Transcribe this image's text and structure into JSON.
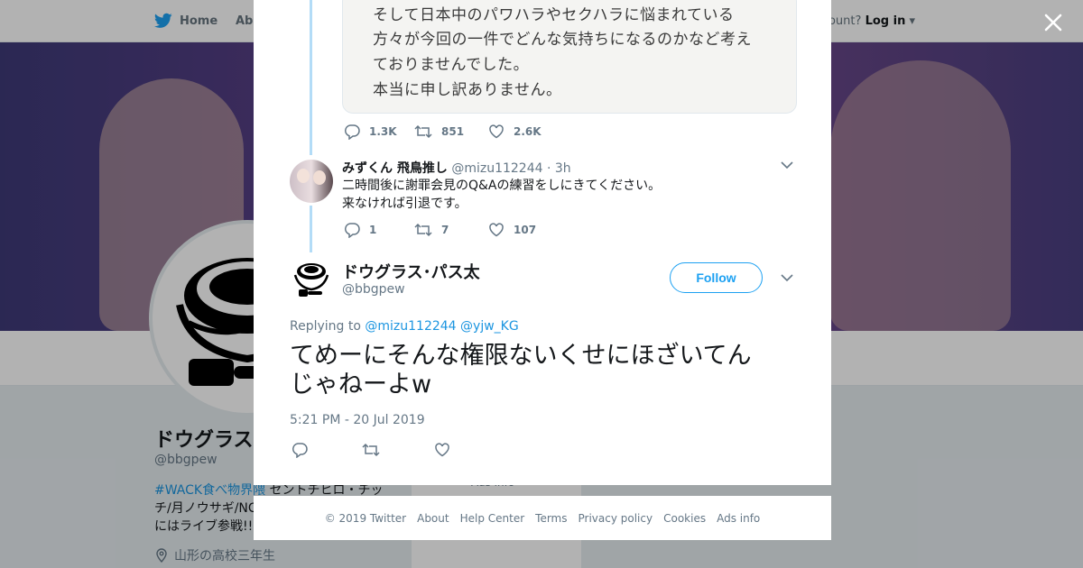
{
  "nav": {
    "home_label": "Home",
    "about_label": "Abo",
    "account_prompt": "ccount?",
    "login_label": "Log in"
  },
  "profile_bg": {
    "name": "ドウグラス",
    "handle": "@bbgpew",
    "bio_tag": "#WACK食べ物界隈",
    "bio_rest_line1": " セントチヒロ・チッ",
    "bio_line2": "チ/月ノウサギ/NC",
    "bio_line3": "にはライブ参戦!!",
    "location": "山形の高校三年生",
    "ads_info": "Ads info"
  },
  "quoted_tweet": {
    "lines": [
      "そして日本中のパワハラやセクハラに悩まれている",
      "方々が今回の一件でどんな気持ちになるのかなど考え",
      "ておりませんでした。",
      "本当に申し訳ありません。"
    ],
    "actions": {
      "replies": "1.3K",
      "retweets": "851",
      "likes": "2.6K"
    }
  },
  "reply_tweet": {
    "name": "みずくん 飛鳥推し",
    "handle": "@mizu112244",
    "separator": "·",
    "time": "3h",
    "lines": [
      "二時間後に謝罪会見のQ&Aの練習をしにきてください。",
      "来なければ引退です。"
    ],
    "actions": {
      "replies": "1",
      "retweets": "7",
      "likes": "107"
    }
  },
  "main_tweet": {
    "name": "ドウグラス･パス太",
    "handle": "@bbgpew",
    "follow_label": "Follow",
    "replying_prefix": "Replying to",
    "replying_mentions": [
      "@mizu112244",
      "@yjw_KG"
    ],
    "text_line1": "てめーにそんな権限ないくせにほざいてん",
    "text_line2": "じゃねーよw",
    "date": "5:21 PM - 20 Jul 2019"
  },
  "footer": {
    "copyright": "© 2019 Twitter",
    "links": [
      "About",
      "Help Center",
      "Terms",
      "Privacy policy",
      "Cookies",
      "Ads info"
    ]
  },
  "colors": {
    "twitter_blue": "#1da1f2",
    "link_blue": "#1b95e0",
    "text_gray": "#657786",
    "thread_line": "#b3dcf7"
  }
}
